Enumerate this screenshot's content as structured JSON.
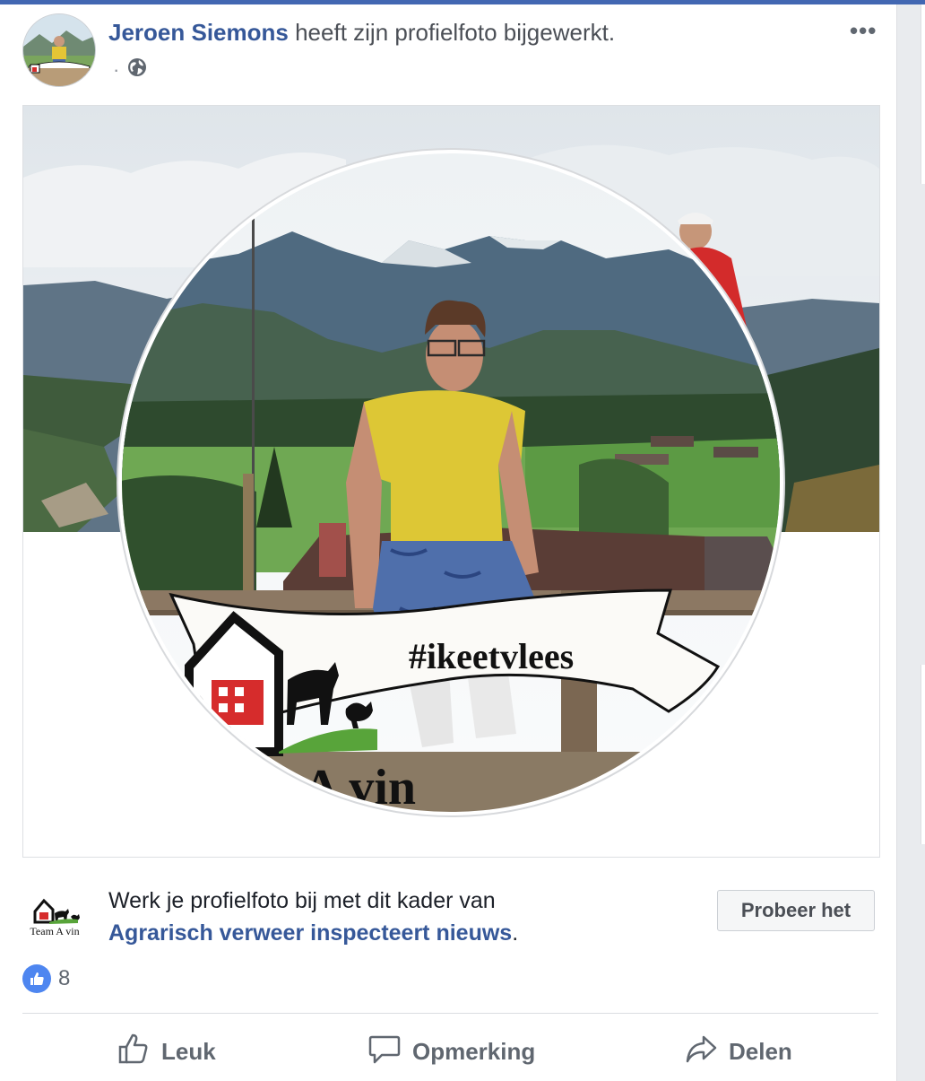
{
  "post": {
    "author": "Jeroen Siemons",
    "action_text": "heeft zijn profielfoto bijgewerkt.",
    "meta_dot": "·",
    "privacy_icon": "globe-icon",
    "more_label": "•••"
  },
  "photo": {
    "frame_banner_text": "#ikeetvlees",
    "frame_partial_text": "A vin"
  },
  "frame_promo": {
    "logo_text": "Team A vin",
    "text": "Werk je profielfoto bij met dit kader van",
    "page_link": "Agrarisch verweer inspecteert nieuws",
    "period": ".",
    "button_label": "Probeer het"
  },
  "reactions": {
    "icon": "like-icon",
    "count": "8"
  },
  "actions": [
    {
      "label": "Leuk",
      "icon": "thumbs-up-icon"
    },
    {
      "label": "Opmerking",
      "icon": "comment-icon"
    },
    {
      "label": "Delen",
      "icon": "share-icon"
    }
  ],
  "colors": {
    "link": "#365899",
    "brand": "#4267b2",
    "like_blue": "#4e86f0",
    "text_secondary": "#606770"
  }
}
